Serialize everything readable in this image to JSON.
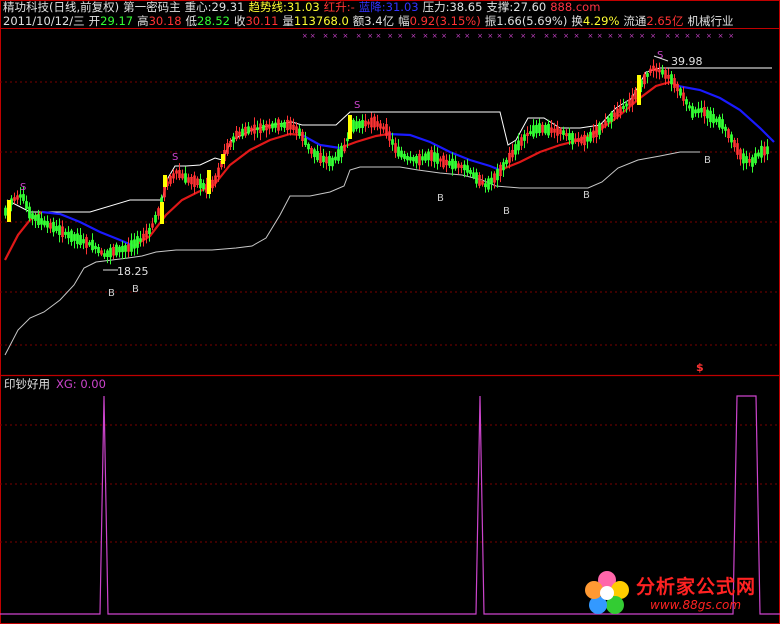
{
  "header": {
    "line1": [
      {
        "k": "stock_name",
        "text": "精功科技(日线,前复权)",
        "color": "#e0e0e0"
      },
      {
        "k": "indicator_name",
        "text": "第一密码主",
        "color": "#e0e0e0"
      },
      {
        "k": "zhongxin_label",
        "text": "重心:",
        "color": "#e0e0e0"
      },
      {
        "k": "zhongxin_value",
        "text": "29.31",
        "color": "#e0e0e0"
      },
      {
        "k": "trend_label",
        "text": "趋势线:",
        "color": "#ffff33"
      },
      {
        "k": "trend_value",
        "text": "31.03",
        "color": "#ffff33"
      },
      {
        "k": "red_rise_label",
        "text": "红升:",
        "color": "#ff3333"
      },
      {
        "k": "red_rise_value",
        "text": "-",
        "color": "#ff3333"
      },
      {
        "k": "blue_fall_label",
        "text": "蓝降:",
        "color": "#3333ff"
      },
      {
        "k": "blue_fall_value",
        "text": "31.03",
        "color": "#3333ff"
      },
      {
        "k": "pressure_label",
        "text": "压力:",
        "color": "#e0e0e0"
      },
      {
        "k": "pressure_value",
        "text": "38.65",
        "color": "#e0e0e0"
      },
      {
        "k": "support_label",
        "text": "支撑:",
        "color": "#e0e0e0"
      },
      {
        "k": "support_value",
        "text": "27.60",
        "color": "#e0e0e0"
      },
      {
        "k": "watermark",
        "text": "888.com",
        "color": "#ff3344"
      }
    ],
    "line2": [
      {
        "k": "date",
        "text": "2011/10/12/三",
        "color": "#e0e0e0"
      },
      {
        "k": "open_label",
        "text": "开",
        "color": "#e0e0e0"
      },
      {
        "k": "open_value",
        "text": "29.17",
        "color": "#33ff33"
      },
      {
        "k": "high_label",
        "text": "高",
        "color": "#e0e0e0"
      },
      {
        "k": "high_value",
        "text": "30.18",
        "color": "#ff3333"
      },
      {
        "k": "low_label",
        "text": "低",
        "color": "#e0e0e0"
      },
      {
        "k": "low_value",
        "text": "28.52",
        "color": "#33ff33"
      },
      {
        "k": "close_label",
        "text": "收",
        "color": "#e0e0e0"
      },
      {
        "k": "close_value",
        "text": "30.11",
        "color": "#ff3333"
      },
      {
        "k": "volume_label",
        "text": "量",
        "color": "#e0e0e0"
      },
      {
        "k": "volume_value",
        "text": "113768.0",
        "color": "#ffff33"
      },
      {
        "k": "amount_label",
        "text": "额",
        "color": "#e0e0e0"
      },
      {
        "k": "amount_value",
        "text": "3.4亿",
        "color": "#e0e0e0"
      },
      {
        "k": "amplitude_label",
        "text": "幅",
        "color": "#e0e0e0"
      },
      {
        "k": "amplitude_value",
        "text": "0.92(3.15%)",
        "color": "#ff3333"
      },
      {
        "k": "swing_label",
        "text": "振",
        "color": "#e0e0e0"
      },
      {
        "k": "swing_value",
        "text": "1.66(5.69%)",
        "color": "#e0e0e0"
      },
      {
        "k": "turnover_label",
        "text": "换",
        "color": "#e0e0e0"
      },
      {
        "k": "turnover_value",
        "text": "4.29%",
        "color": "#ffff33"
      },
      {
        "k": "float_label",
        "text": "流通",
        "color": "#e0e0e0"
      },
      {
        "k": "float_value",
        "text": "2.65亿",
        "color": "#ff3333"
      },
      {
        "k": "industry",
        "text": "机械行业",
        "color": "#e0e0e0"
      }
    ]
  },
  "main_chart": {
    "annotations": {
      "high_price": "39.98",
      "low_price": "18.25",
      "sell_mark": "S",
      "buy_mark": "B",
      "dollar_mark": "$"
    }
  },
  "sub_panel": {
    "title": "印钞好用",
    "xg_label": "XG: 0.00"
  },
  "site_logo": {
    "brand": "分析家公式网",
    "url": "www.88gs.com"
  },
  "colors": {
    "background": "#000000",
    "up_candle": "#ff3333",
    "down_candle": "#33ff33",
    "rise_line": "#e01818",
    "fall_line": "#1a1aff",
    "support_line": "#c8c8c8",
    "pressure_line": "#ffffff",
    "signal_bar": "#ffff00",
    "panel_divider": "#c00000",
    "grid": "#7a0000",
    "sub_signal": "#cc44cc"
  }
}
